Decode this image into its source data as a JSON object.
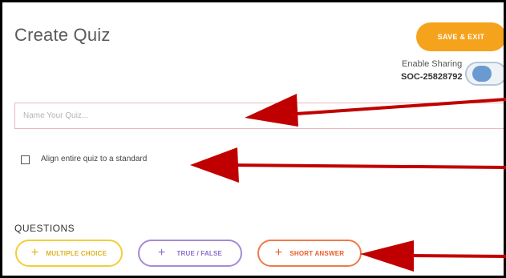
{
  "header": {
    "title": "Create Quiz",
    "save_label": "SAVE & EXIT"
  },
  "sharing": {
    "label": "Enable Sharing",
    "code": "SOC-25828792",
    "enabled": true
  },
  "quiz_name": {
    "placeholder": "Name Your Quiz...",
    "value": ""
  },
  "align": {
    "label": "Align entire quiz to a standard",
    "checked": false
  },
  "questions": {
    "heading": "QUESTIONS",
    "buttons": [
      {
        "label": "MULTIPLE CHOICE",
        "icon": "plus-icon",
        "color": "#f0cf3a"
      },
      {
        "label": "TRUE / FALSE",
        "icon": "plus-icon",
        "color": "#a58ad6"
      },
      {
        "label": "SHORT ANSWER",
        "icon": "plus-icon",
        "color": "#ef7a4a"
      }
    ]
  },
  "annotations": {
    "arrow_color": "#c00000"
  }
}
